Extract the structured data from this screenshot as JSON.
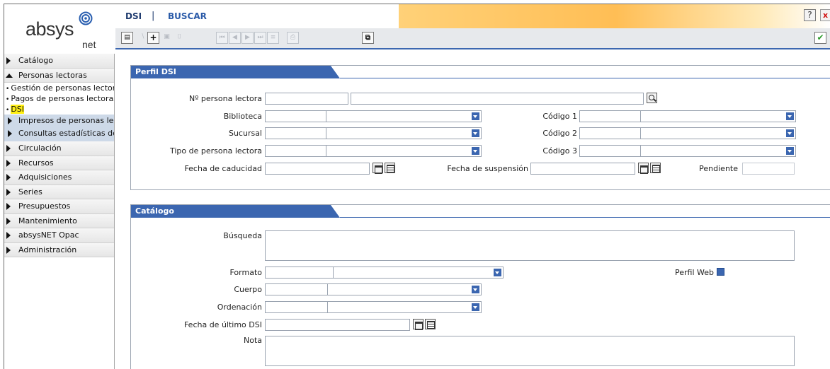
{
  "app": {
    "logo_text": "absys",
    "logo_sub": "net",
    "logo_icon": "spiral-logo-icon"
  },
  "title": {
    "module": "DSI",
    "separator": "|",
    "action": "BUSCAR",
    "help": "?",
    "close": "x"
  },
  "sidebar": {
    "items": [
      {
        "label": "Catálogo",
        "type": "module"
      },
      {
        "label": "Personas lectoras",
        "type": "module-open"
      },
      {
        "label": "Gestión de personas lectoras",
        "type": "sub"
      },
      {
        "label": "Pagos de personas lectoras",
        "type": "sub"
      },
      {
        "label": "DSI",
        "type": "sub-active"
      },
      {
        "label": "Impresos de personas lectoras",
        "type": "group"
      },
      {
        "label": "Consultas estadísticas de personas lectoras",
        "type": "group"
      },
      {
        "label": "Circulación",
        "type": "module"
      },
      {
        "label": "Recursos",
        "type": "module"
      },
      {
        "label": "Adquisiciones",
        "type": "module"
      },
      {
        "label": "Series",
        "type": "module"
      },
      {
        "label": "Presupuestos",
        "type": "module"
      },
      {
        "label": "Mantenimiento",
        "type": "module"
      },
      {
        "label": "absysNET Opac",
        "type": "module"
      },
      {
        "label": "Administración",
        "type": "module"
      }
    ]
  },
  "toolbar": {
    "add": "+",
    "icons": [
      "record-menu-icon",
      "add-icon",
      "edit-icon",
      "delete-icon",
      "first-icon",
      "prev-icon",
      "next-icon",
      "last-icon",
      "list-icon",
      "print-icon",
      "copy-icon",
      "accept-icon"
    ],
    "accept": "✔"
  },
  "perfil": {
    "title": "Perfil DSI",
    "persona_label": "Nº persona lectora",
    "biblioteca_label": "Biblioteca",
    "sucursal_label": "Sucursal",
    "tipo_label": "Tipo de persona lectora",
    "caducidad_label": "Fecha de caducidad",
    "codigo1_label": "Código 1",
    "codigo2_label": "Código 2",
    "codigo3_label": "Código 3",
    "suspension_label": "Fecha de suspensión",
    "pendiente_label": "Pendiente"
  },
  "catalogo": {
    "title": "Catálogo",
    "busqueda_label": "Búsqueda",
    "formato_label": "Formato",
    "cuerpo_label": "Cuerpo",
    "ordenacion_label": "Ordenación",
    "fecha_dsi_label": "Fecha de último DSI",
    "nota_label": "Nota",
    "perfil_web_label": "Perfil Web"
  }
}
